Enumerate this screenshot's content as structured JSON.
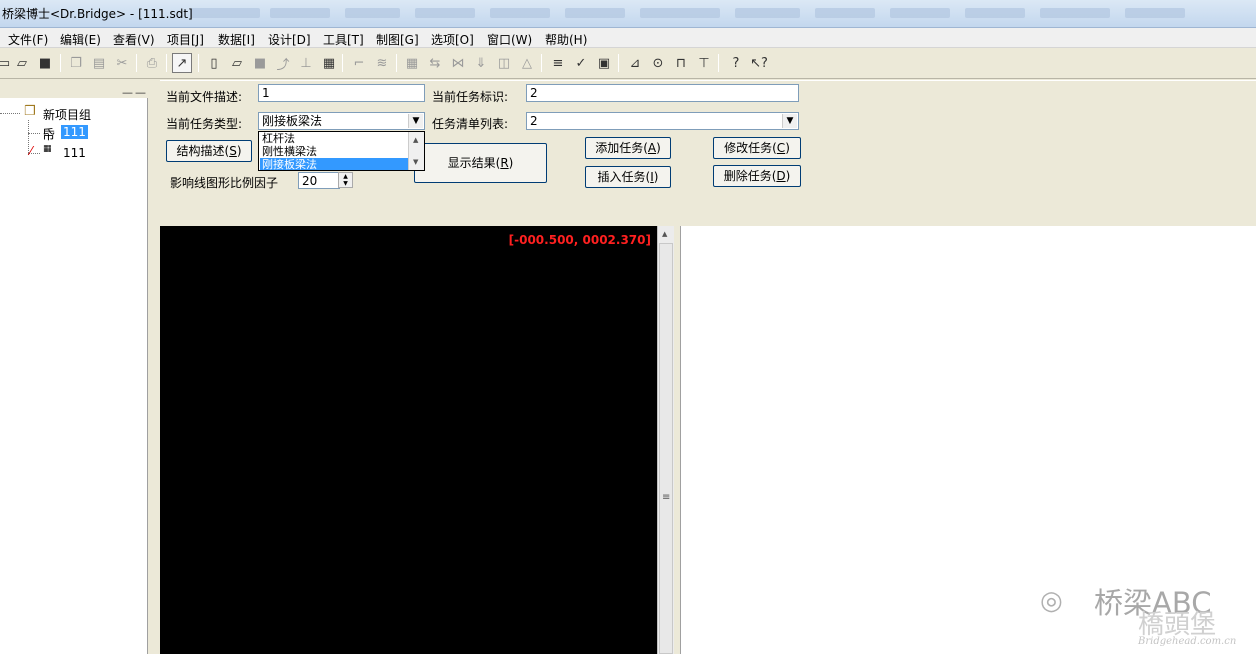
{
  "window": {
    "title": "桥梁博士<Dr.Bridge> - [111.sdt]"
  },
  "menu": [
    {
      "label": "文件(F)"
    },
    {
      "label": "编辑(E)"
    },
    {
      "label": "查看(V)"
    },
    {
      "label": "项目[J]"
    },
    {
      "label": "数据[I]"
    },
    {
      "label": "设计[D]"
    },
    {
      "label": "工具[T]"
    },
    {
      "label": "制图[G]"
    },
    {
      "label": "选项[O]"
    },
    {
      "label": "窗口(W)"
    },
    {
      "label": "帮助(H)"
    }
  ],
  "toolbar": {
    "icons": [
      "open-icon",
      "folder-open-icon",
      "save-icon",
      "copy-icon",
      "paste-icon",
      "cut-icon",
      "print-icon",
      "graph-view-icon",
      "new-doc-icon",
      "open-doc-icon",
      "save-doc-icon",
      "tool-a-icon",
      "tool-b-icon",
      "calculator-icon",
      "line-icon",
      "beam-icon",
      "grid-icon",
      "arrow-icon",
      "node-icon",
      "load-icon",
      "section-icon",
      "triangle-icon",
      "list-icon",
      "check-icon",
      "table-icon",
      "slope-icon",
      "circle-icon",
      "structure-icon",
      "shear-icon",
      "help-icon",
      "context-help-icon"
    ]
  },
  "tree": {
    "group_label": "新项目组",
    "item1_label": "111",
    "item2_label": "111"
  },
  "form": {
    "file_desc_label": "当前文件描述:",
    "file_desc_value": "1",
    "task_id_label": "当前任务标识:",
    "task_id_value": "2",
    "task_type_label": "当前任务类型:",
    "task_type_value": "刚接板梁法",
    "task_list_label": "任务清单列表:",
    "task_list_value": "2",
    "struct_desc_label": "结构描述(",
    "struct_desc_key": "S",
    "show_result_label": "显示结果(",
    "show_result_key": "R",
    "add_task_label": "添加任务(",
    "add_task_key": "A",
    "insert_task_label": "插入任务(",
    "insert_task_key": "I",
    "modify_task_label": "修改任务(",
    "modify_task_key": "C",
    "delete_task_label": "删除任务(",
    "delete_task_key": "D",
    "scale_label": "影响线图形比例因子",
    "scale_value": "20",
    "dropdown_options": [
      "杠杆法",
      "刚性横梁法",
      "刚接板梁法"
    ],
    "dropdown_selected_index": 2
  },
  "view": {
    "coordinates": "[-000.500, 0002.370]"
  },
  "watermark": {
    "brand": "桥梁ABC",
    "site_cn": "橋頭堡",
    "url": "Bridgehead.com.cn"
  }
}
